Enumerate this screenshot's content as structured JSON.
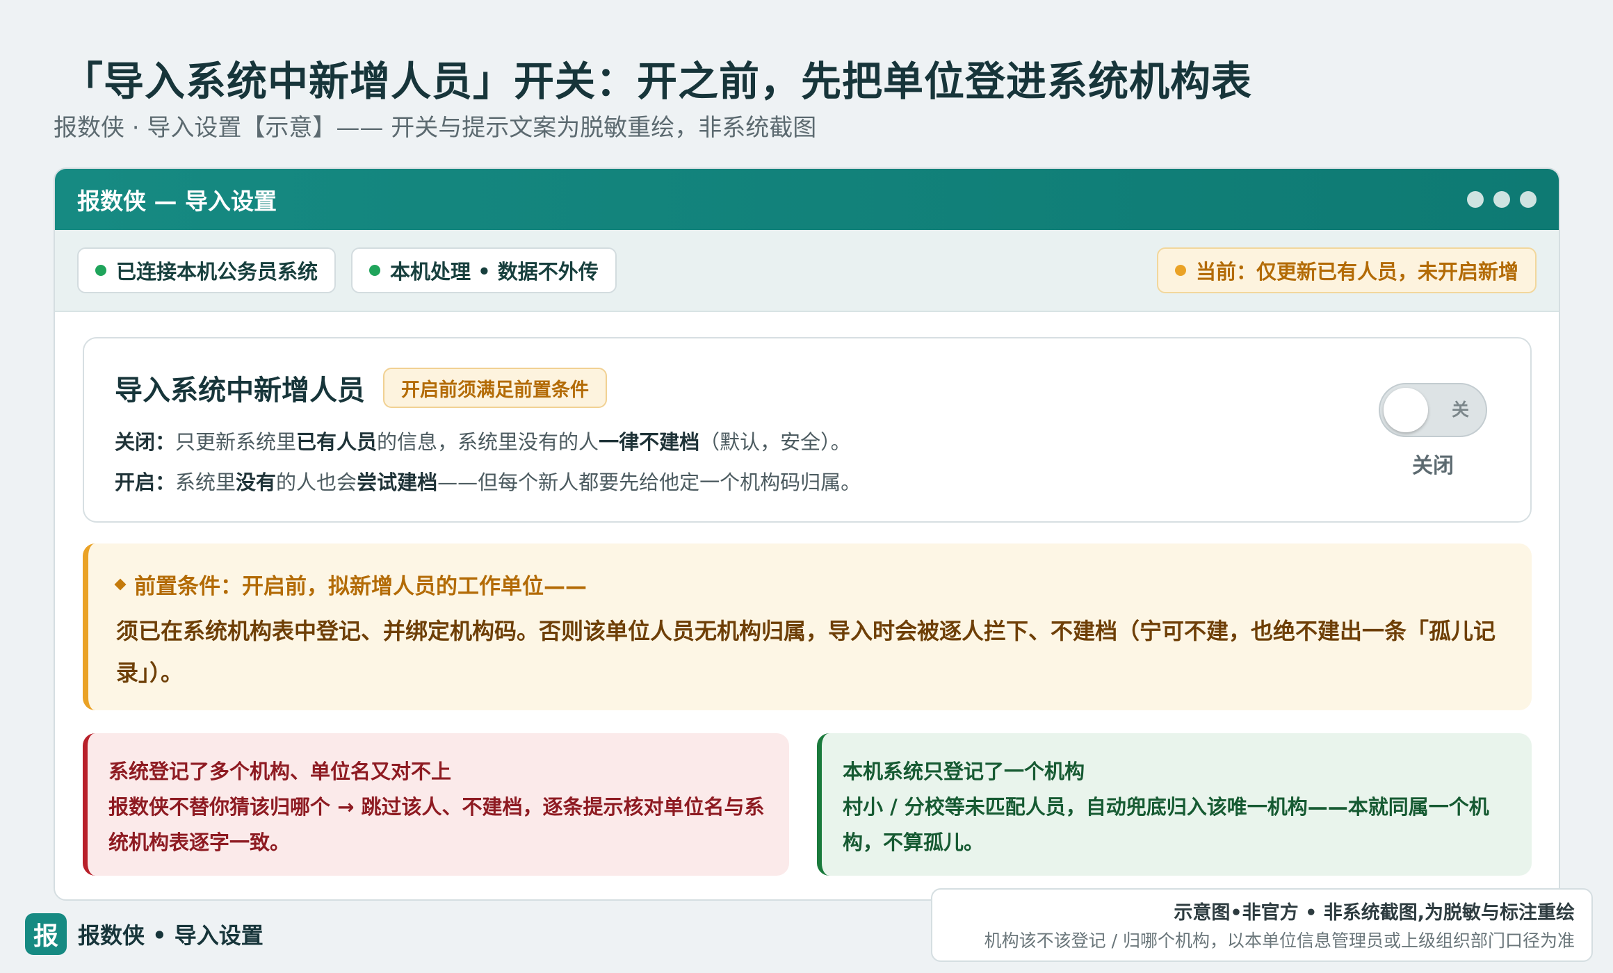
{
  "page": {
    "title": "「导入系统中新增人员」开关：开之前，先把单位登进系统机构表",
    "subtitle": "报数侠 · 导入设置【示意】—— 开关与提示文案为脱敏重绘，非系统截图"
  },
  "window": {
    "title": "报数侠 — 导入设置"
  },
  "status": {
    "connected": "已连接本机公务员系统",
    "local": "本机处理 • 数据不外传",
    "current": "当前：仅更新已有人员，未开启新增"
  },
  "setting": {
    "title": "导入系统中新增人员",
    "badge": "开启前须满足前置条件",
    "off_label": "关闭：",
    "off_t1": "只更新系统里",
    "off_b1": "已有人员",
    "off_t2": "的信息，系统里没有的人",
    "off_b2": "一律不建档",
    "off_t3": "（默认，安全）。",
    "on_label": "开启：",
    "on_t1": "系统里",
    "on_b1": "没有",
    "on_t2": "的人也会",
    "on_b2": "尝试建档",
    "on_t3": "——但每个新人都要先给他定一个机构码归属。",
    "toggle_text": "关",
    "toggle_state": "关闭"
  },
  "notice": {
    "head": "前置条件：开启前，拟新增人员的工作单位——",
    "body": "须已在系统机构表中登记、并绑定机构码。否则该单位人员无机构归属，导入时会被逐人拦下、不建档（宁可不建，也绝不建出一条「孤儿记录」）。"
  },
  "cases": {
    "multi": {
      "title": "系统登记了多个机构、单位名又对不上",
      "body": "报数侠不替你猜该归哪个 → 跳过该人、不建档，逐条提示核对单位名与系统机构表逐字一致。"
    },
    "single": {
      "title": "本机系统只登记了一个机构",
      "body": "村小 / 分校等未匹配人员，自动兜底归入该唯一机构——本就同属一个机构，不算孤儿。"
    }
  },
  "footer": {
    "logo_char": "报",
    "brand": "报数侠 • 导入设置",
    "disclaimer_main": "示意图•非官方 • 非系统截图,为脱敏与标注重绘",
    "disclaimer_sub": "机构该不该登记 / 归哪个机构，以本单位信息管理员或上级组织部门口径为准"
  },
  "colors": {
    "brand_teal": "#168a82",
    "warn_orange": "#eaa226",
    "danger_red": "#b8202a",
    "success_green": "#1a7a3c"
  }
}
